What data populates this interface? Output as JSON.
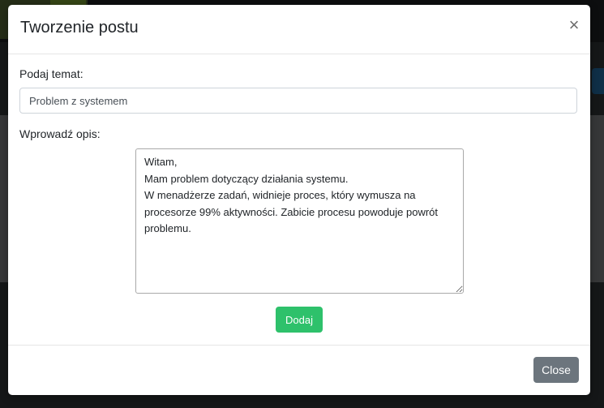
{
  "modal": {
    "title": "Tworzenie postu",
    "close_icon": "close-icon",
    "close_glyph": "×"
  },
  "form": {
    "topic_label": "Podaj temat:",
    "topic_value": "Problem z systemem",
    "description_label": "Wprowadź opis:",
    "description_value": "Witam,\nMam problem dotyczący działania systemu.\nW menadżerze zadań, widnieje proces, który wymusza na procesorze 99% aktywności. Zabicie procesu powoduje powrót problemu.",
    "add_button_label": "Dodaj"
  },
  "footer": {
    "close_button_label": "Close"
  },
  "colors": {
    "add_button": "#2ec16b",
    "close_button": "#6c757d",
    "overlay": "rgba(0,0,0,0.5)"
  }
}
